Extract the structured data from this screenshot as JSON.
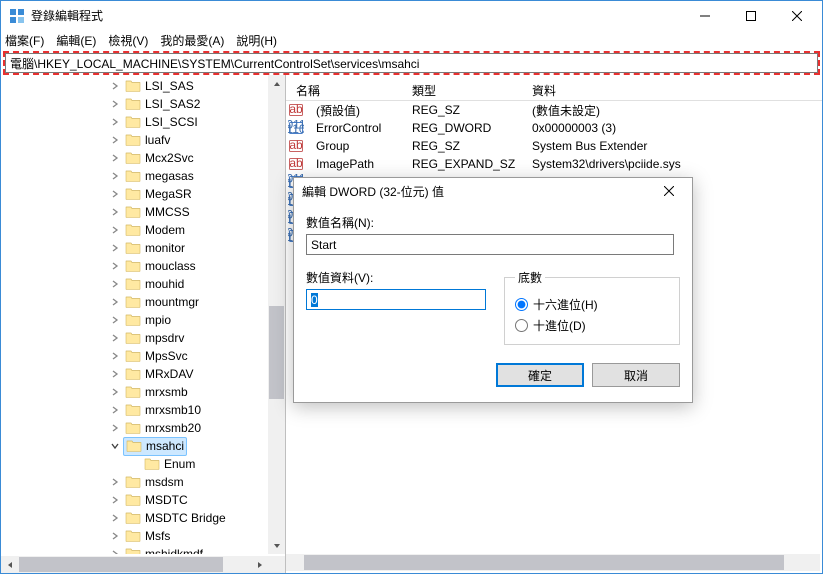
{
  "window": {
    "title": "登錄編輯程式"
  },
  "menu": {
    "file": "檔案(F)",
    "edit": "編輯(E)",
    "view": "檢視(V)",
    "fav": "我的最愛(A)",
    "help": "說明(H)"
  },
  "address": {
    "value": "電腦\\HKEY_LOCAL_MACHINE\\SYSTEM\\CurrentControlSet\\services\\msahci"
  },
  "tree": [
    {
      "label": "LSI_SAS",
      "expandable": true
    },
    {
      "label": "LSI_SAS2",
      "expandable": true
    },
    {
      "label": "LSI_SCSI",
      "expandable": true
    },
    {
      "label": "luafv",
      "expandable": true
    },
    {
      "label": "Mcx2Svc",
      "expandable": true
    },
    {
      "label": "megasas",
      "expandable": true
    },
    {
      "label": "MegaSR",
      "expandable": true
    },
    {
      "label": "MMCSS",
      "expandable": true
    },
    {
      "label": "Modem",
      "expandable": true
    },
    {
      "label": "monitor",
      "expandable": true
    },
    {
      "label": "mouclass",
      "expandable": true
    },
    {
      "label": "mouhid",
      "expandable": true
    },
    {
      "label": "mountmgr",
      "expandable": true
    },
    {
      "label": "mpio",
      "expandable": true
    },
    {
      "label": "mpsdrv",
      "expandable": true
    },
    {
      "label": "MpsSvc",
      "expandable": true
    },
    {
      "label": "MRxDAV",
      "expandable": true
    },
    {
      "label": "mrxsmb",
      "expandable": true
    },
    {
      "label": "mrxsmb10",
      "expandable": true
    },
    {
      "label": "mrxsmb20",
      "expandable": true
    },
    {
      "label": "msahci",
      "expandable": true,
      "selected": true,
      "expanded": true
    },
    {
      "label": "Enum",
      "depth": "child",
      "nochild": true
    },
    {
      "label": "msdsm",
      "expandable": true
    },
    {
      "label": "MSDTC",
      "expandable": true
    },
    {
      "label": "MSDTC Bridge",
      "expandable": true
    },
    {
      "label": "Msfs",
      "expandable": true
    },
    {
      "label": "mshidkmdf",
      "expandable": true
    }
  ],
  "list": {
    "headers": {
      "name": "名稱",
      "type": "類型",
      "data": "資料"
    },
    "rows": [
      {
        "icon": "sz",
        "name": "(預設值)",
        "type": "REG_SZ",
        "data": "(數值未設定)"
      },
      {
        "icon": "dw",
        "name": "ErrorControl",
        "type": "REG_DWORD",
        "data": "0x00000003 (3)"
      },
      {
        "icon": "sz",
        "name": "Group",
        "type": "REG_SZ",
        "data": "System Bus Extender"
      },
      {
        "icon": "sz",
        "name": "ImagePath",
        "type": "REG_EXPAND_SZ",
        "data": "System32\\drivers\\pciide.sys"
      }
    ],
    "partial": [
      {
        "icon": "dw"
      },
      {
        "icon": "dw"
      },
      {
        "icon": "dw"
      },
      {
        "icon": "dw"
      }
    ]
  },
  "dialog": {
    "title": "編輯 DWORD (32-位元) 值",
    "name_label": "數值名稱(N):",
    "name_value": "Start",
    "data_label": "數值資料(V):",
    "data_value": "0",
    "base_label": "底數",
    "radio_hex": "十六進位(H)",
    "radio_dec": "十進位(D)",
    "ok": "確定",
    "cancel": "取消"
  }
}
